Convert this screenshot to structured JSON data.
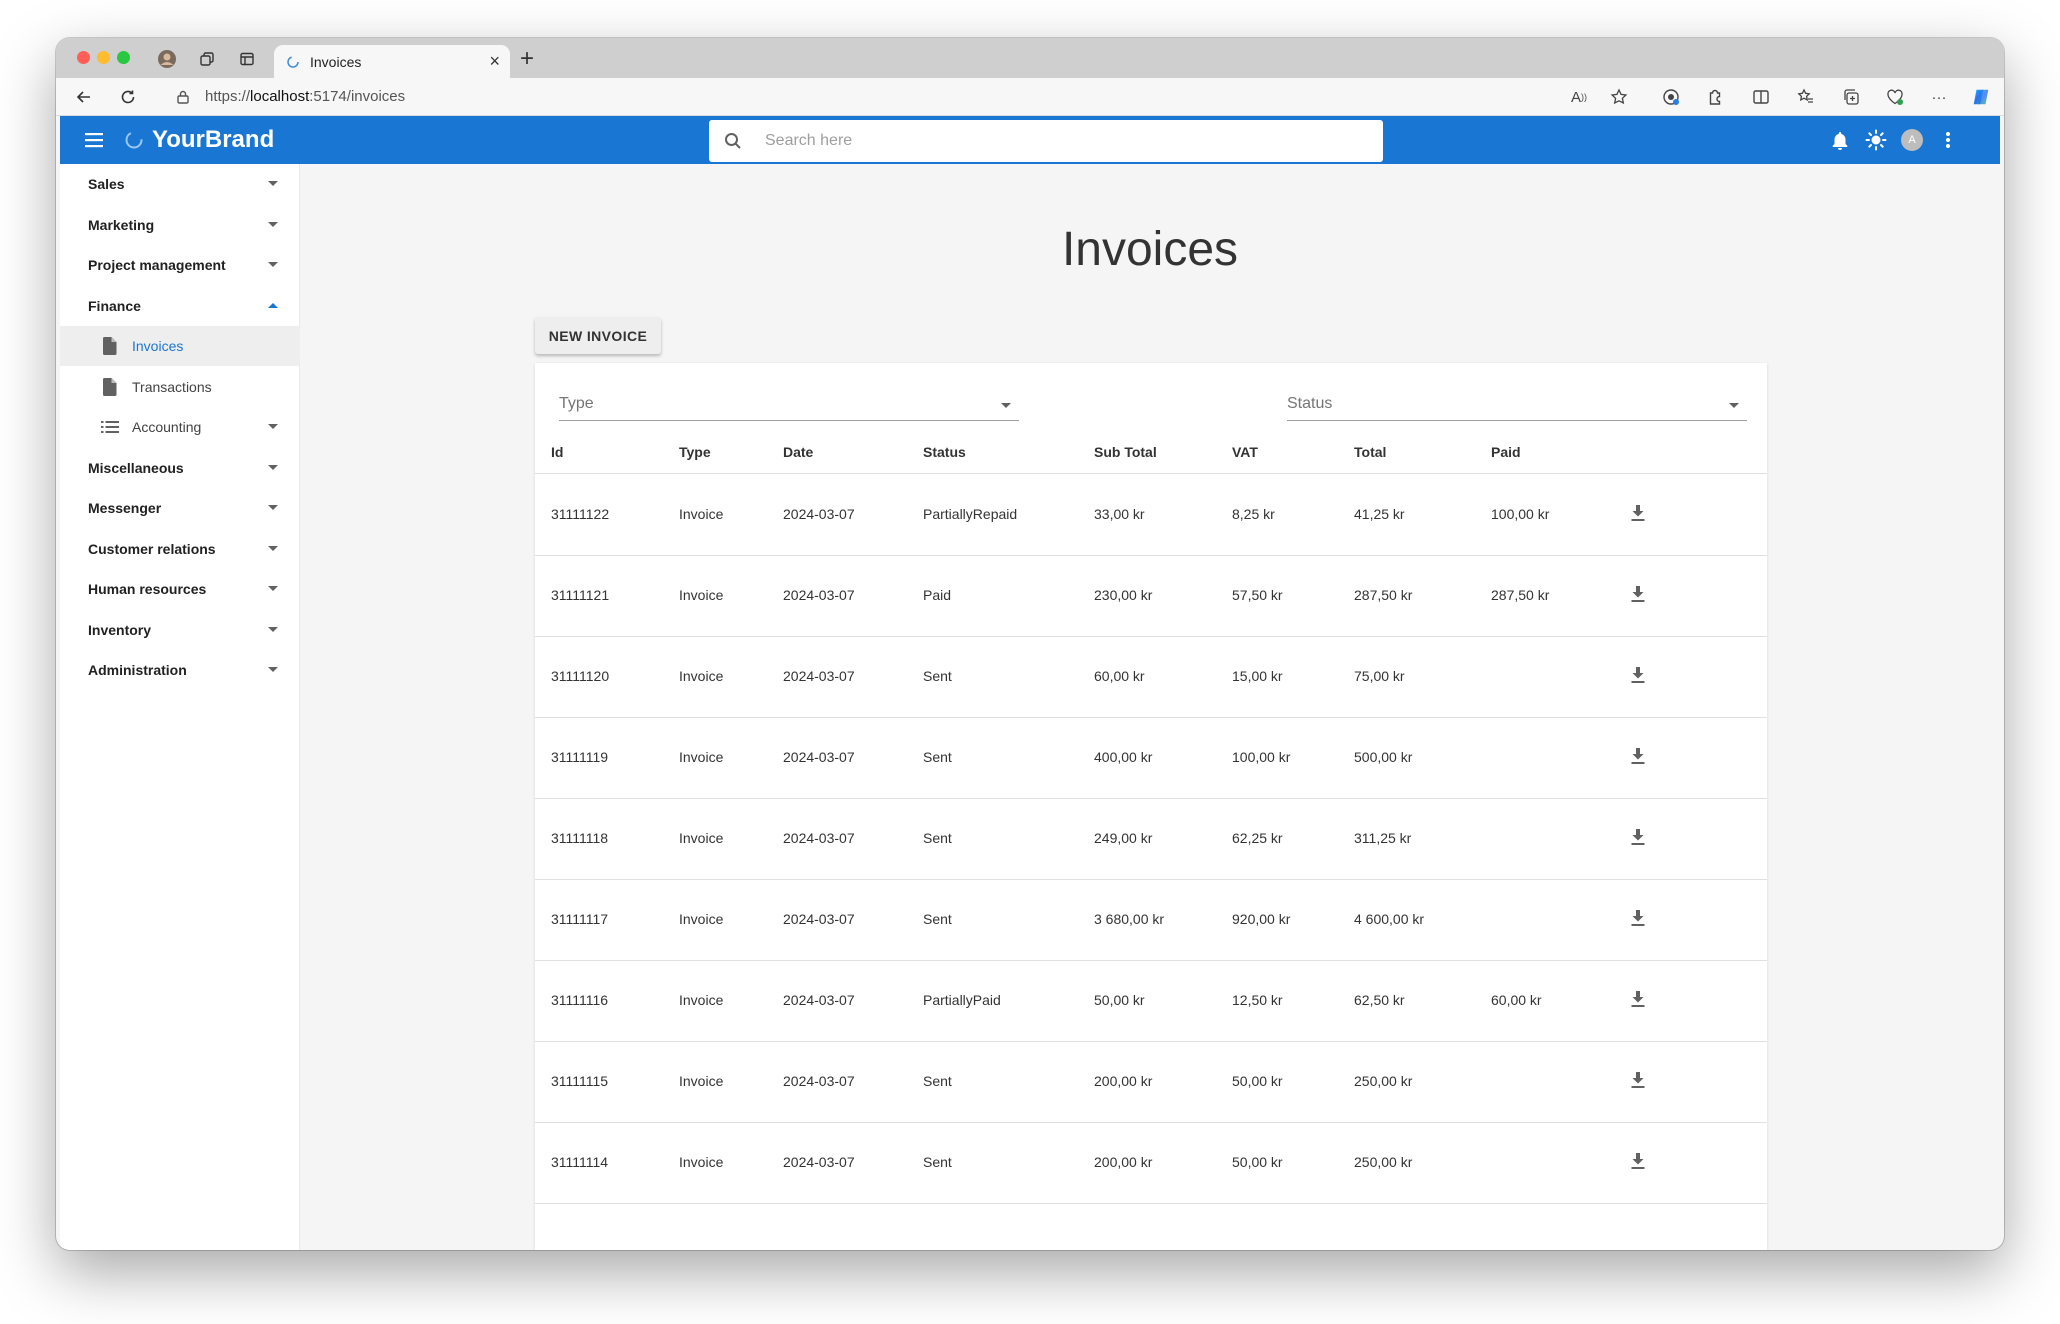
{
  "browser": {
    "tab_title": "Invoices",
    "url_prefix": "https://",
    "url_host": "localhost",
    "url_rest": ":5174/invoices"
  },
  "appbar": {
    "brand": "YourBrand",
    "search_placeholder": "Search here",
    "avatar_initial": "A",
    "color": "#1976d2"
  },
  "sidebar": {
    "items": [
      {
        "label": "Sales"
      },
      {
        "label": "Marketing"
      },
      {
        "label": "Project management"
      },
      {
        "label": "Finance"
      },
      {
        "label": "Miscellaneous"
      },
      {
        "label": "Messenger"
      },
      {
        "label": "Customer relations"
      },
      {
        "label": "Human resources"
      },
      {
        "label": "Inventory"
      },
      {
        "label": "Administration"
      }
    ],
    "finance_children": [
      {
        "label": "Invoices",
        "icon": "document-icon",
        "active": true
      },
      {
        "label": "Transactions",
        "icon": "document-icon"
      },
      {
        "label": "Accounting",
        "icon": "list-icon"
      }
    ]
  },
  "main": {
    "title": "Invoices",
    "new_button": "NEW INVOICE",
    "filters": {
      "type_label": "Type",
      "status_label": "Status"
    },
    "columns": [
      "Id",
      "Type",
      "Date",
      "Status",
      "Sub Total",
      "VAT",
      "Total",
      "Paid"
    ],
    "rows": [
      {
        "id": "31111122",
        "type": "Invoice",
        "date": "2024-03-07",
        "status": "PartiallyRepaid",
        "subtotal": "33,00 kr",
        "vat": "8,25 kr",
        "total": "41,25 kr",
        "paid": "100,00 kr"
      },
      {
        "id": "31111121",
        "type": "Invoice",
        "date": "2024-03-07",
        "status": "Paid",
        "subtotal": "230,00 kr",
        "vat": "57,50 kr",
        "total": "287,50 kr",
        "paid": "287,50 kr"
      },
      {
        "id": "31111120",
        "type": "Invoice",
        "date": "2024-03-07",
        "status": "Sent",
        "subtotal": "60,00 kr",
        "vat": "15,00 kr",
        "total": "75,00 kr",
        "paid": ""
      },
      {
        "id": "31111119",
        "type": "Invoice",
        "date": "2024-03-07",
        "status": "Sent",
        "subtotal": "400,00 kr",
        "vat": "100,00 kr",
        "total": "500,00 kr",
        "paid": ""
      },
      {
        "id": "31111118",
        "type": "Invoice",
        "date": "2024-03-07",
        "status": "Sent",
        "subtotal": "249,00 kr",
        "vat": "62,25 kr",
        "total": "311,25 kr",
        "paid": ""
      },
      {
        "id": "31111117",
        "type": "Invoice",
        "date": "2024-03-07",
        "status": "Sent",
        "subtotal": "3 680,00 kr",
        "vat": "920,00 kr",
        "total": "4 600,00 kr",
        "paid": ""
      },
      {
        "id": "31111116",
        "type": "Invoice",
        "date": "2024-03-07",
        "status": "PartiallyPaid",
        "subtotal": "50,00 kr",
        "vat": "12,50 kr",
        "total": "62,50 kr",
        "paid": "60,00 kr"
      },
      {
        "id": "31111115",
        "type": "Invoice",
        "date": "2024-03-07",
        "status": "Sent",
        "subtotal": "200,00 kr",
        "vat": "50,00 kr",
        "total": "250,00 kr",
        "paid": ""
      },
      {
        "id": "31111114",
        "type": "Invoice",
        "date": "2024-03-07",
        "status": "Sent",
        "subtotal": "200,00 kr",
        "vat": "50,00 kr",
        "total": "250,00 kr",
        "paid": ""
      }
    ]
  }
}
